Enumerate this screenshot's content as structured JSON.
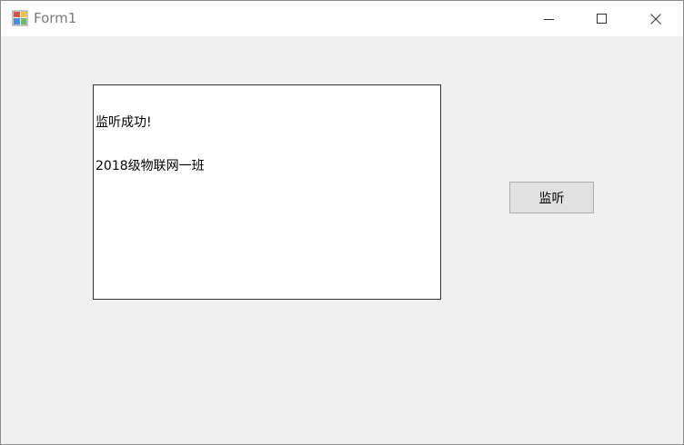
{
  "window": {
    "title": "Form1"
  },
  "titlebar": {
    "app_icon": "winforms-app-icon",
    "minimize_icon": "minimize-icon",
    "maximize_icon": "maximize-icon",
    "close_icon": "close-icon"
  },
  "textbox": {
    "lines": [
      "监听成功!",
      "2018级物联网一班"
    ]
  },
  "button": {
    "label": "监听"
  },
  "colors": {
    "form_background": "#f0f0f0",
    "titlebar_background": "#ffffff",
    "button_background": "#e1e1e1",
    "button_border": "#adadad",
    "textbox_border": "#333333"
  }
}
